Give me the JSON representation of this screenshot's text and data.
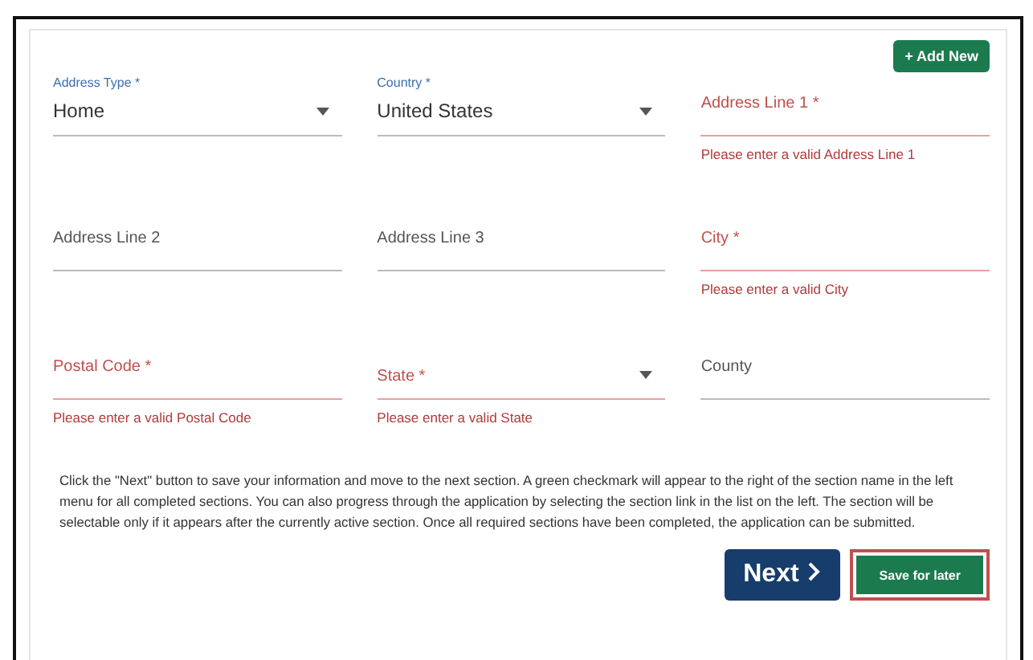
{
  "add_button": "+ Add New",
  "fields": [
    {
      "kind": "select",
      "label": "Address Type *",
      "value": "Home"
    },
    {
      "kind": "select",
      "label": "Country *",
      "value": "United States"
    },
    {
      "kind": "text",
      "label": "Address Line 1 *",
      "invalid": true,
      "error": "Please enter a valid Address Line 1"
    },
    {
      "kind": "text",
      "label": "Address Line 2",
      "invalid": false
    },
    {
      "kind": "text",
      "label": "Address Line 3",
      "invalid": false
    },
    {
      "kind": "text",
      "label": "City *",
      "invalid": true,
      "error": "Please enter a valid City"
    },
    {
      "kind": "text",
      "label": "Postal Code *",
      "invalid": true,
      "error": "Please enter a valid Postal Code"
    },
    {
      "kind": "select",
      "label": "State *",
      "invalid": true,
      "error": "Please enter a valid State"
    },
    {
      "kind": "text",
      "label": "County",
      "invalid": false
    }
  ],
  "instructions": "Click the \"Next\" button to save your information and move to the next section. A green checkmark will appear to the right of the section name in the left menu for all completed sections. You can also progress through the application by selecting the section link in the list on the left. The section will be selectable only if it appears after the currently active section. Once all required sections have been completed, the application can be submitted.",
  "buttons": [
    {
      "kind": "next",
      "label": "Next"
    },
    {
      "kind": "save",
      "label": "Save for later",
      "selected": true
    }
  ]
}
